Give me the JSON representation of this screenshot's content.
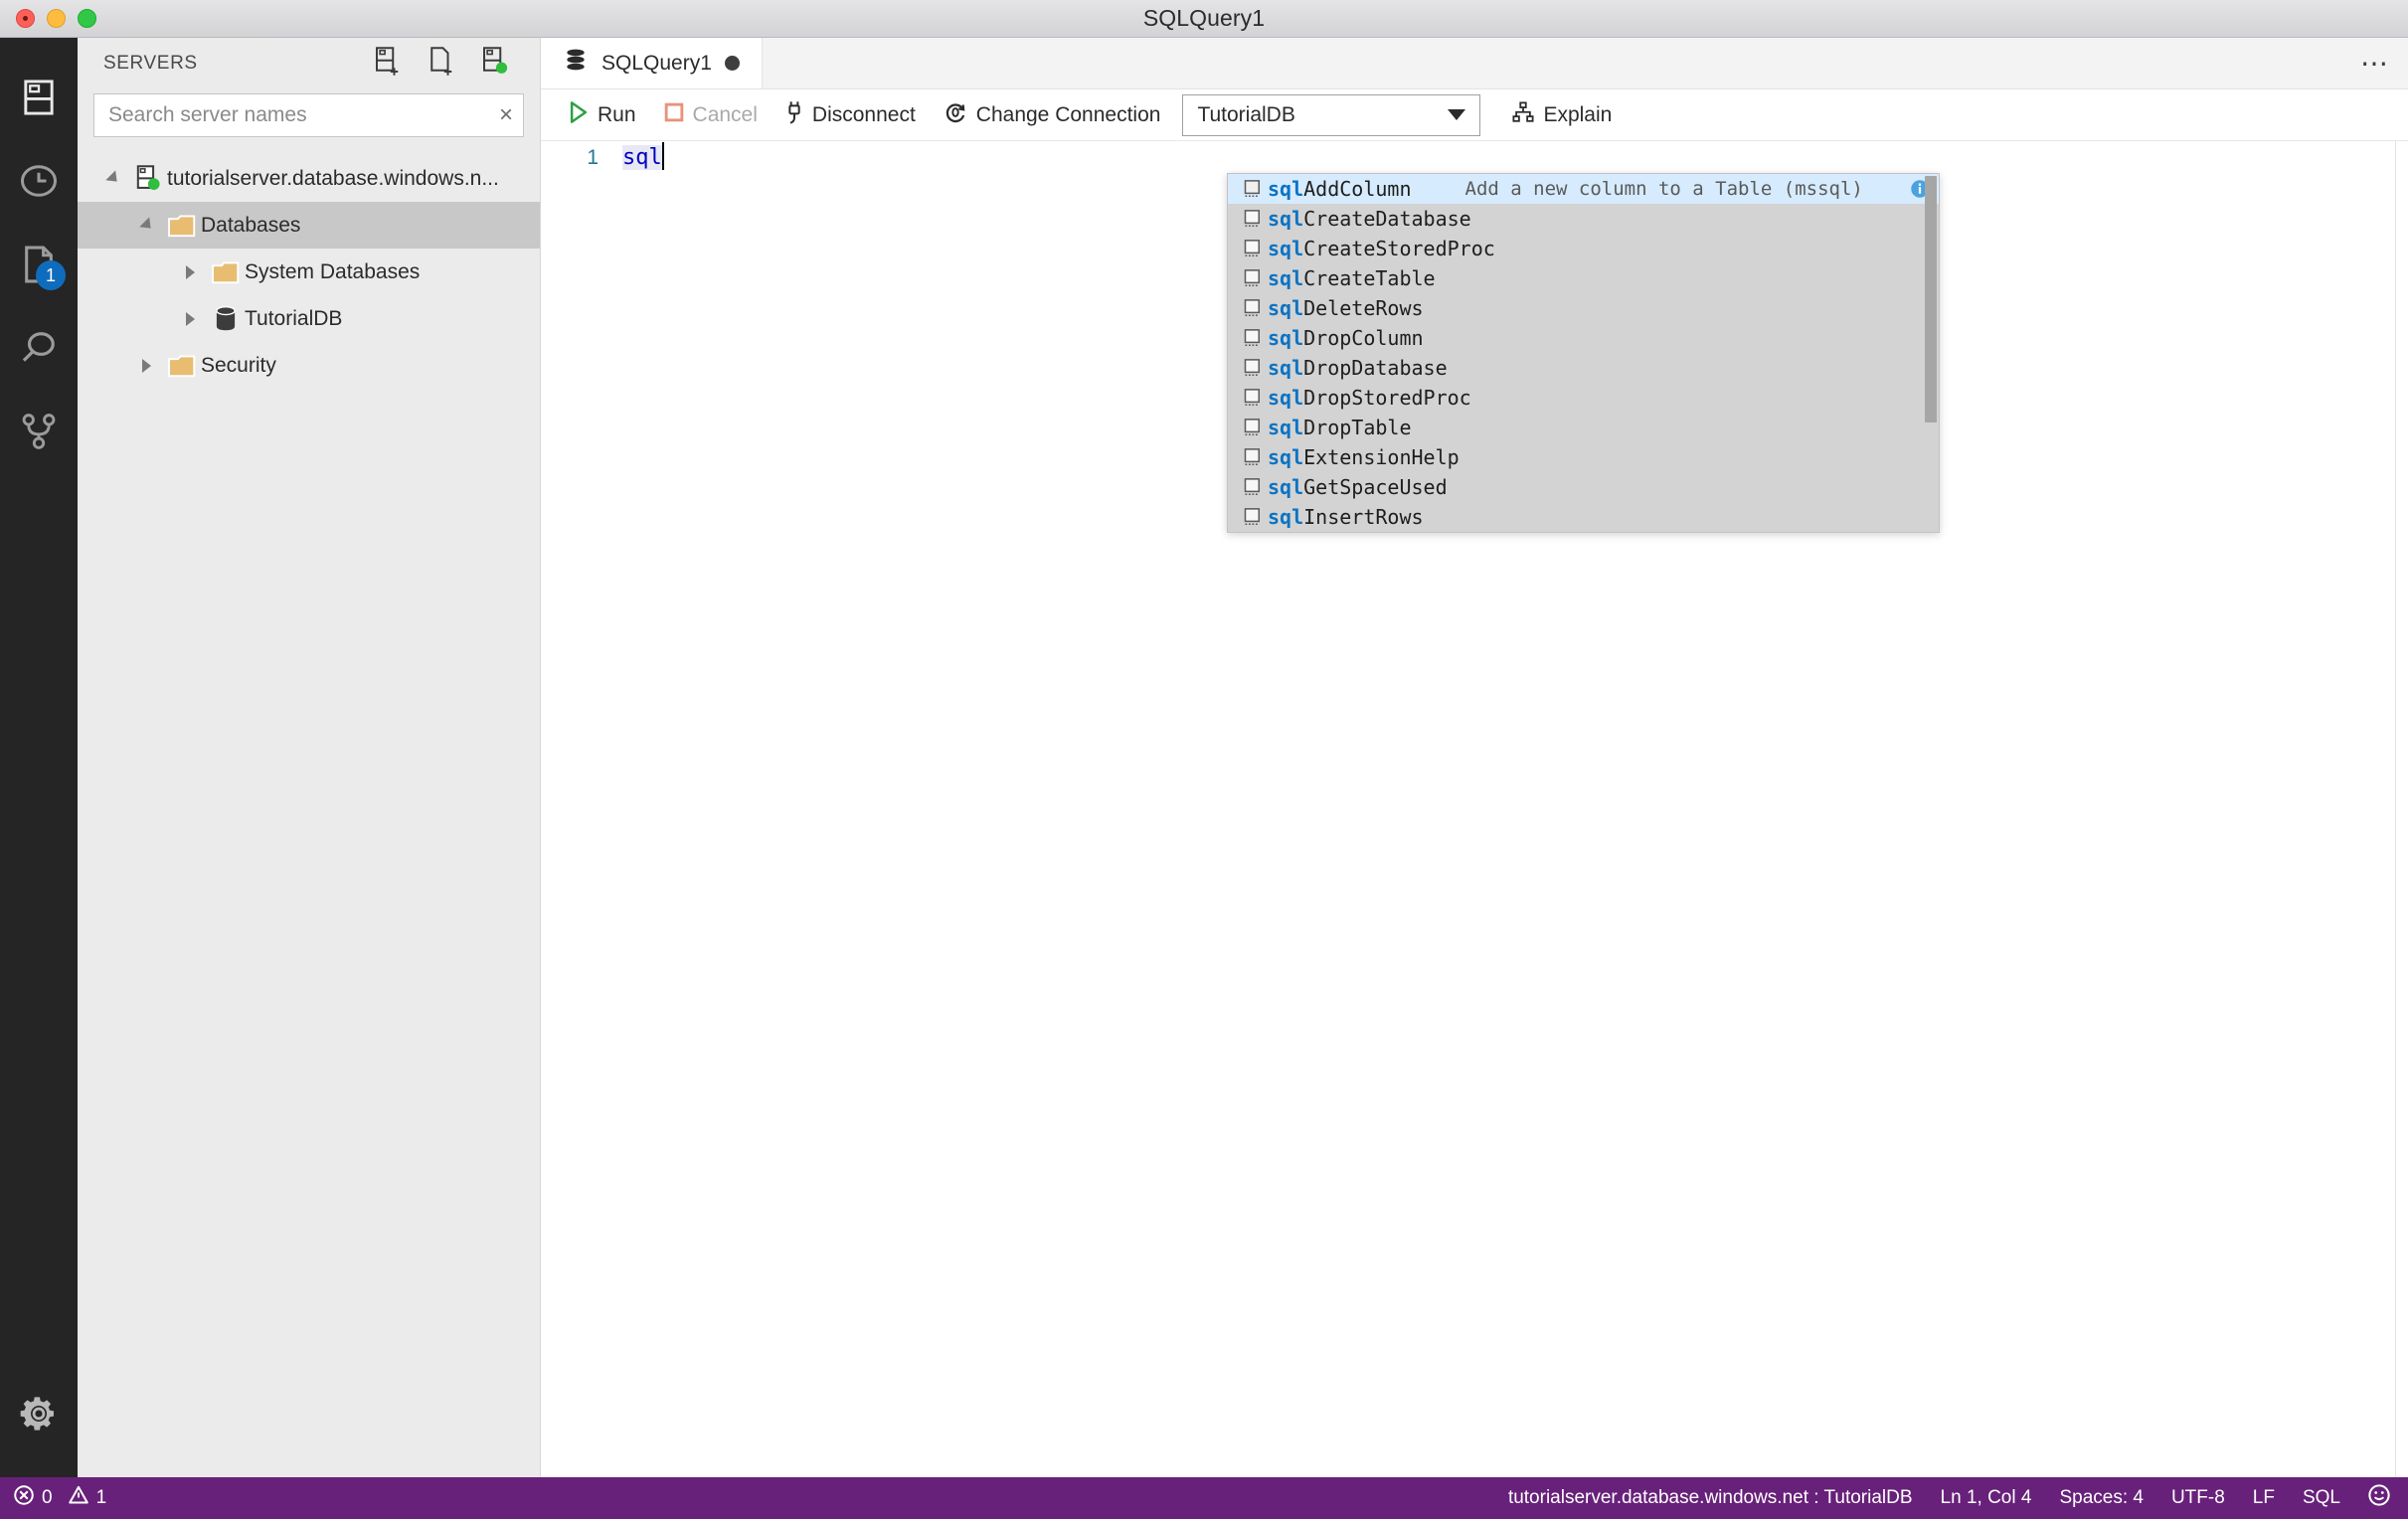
{
  "window": {
    "title": "SQLQuery1",
    "traffic_lights": [
      "close-button",
      "minimize-button",
      "maximize-button"
    ]
  },
  "activity_bar": {
    "items": [
      {
        "name": "servers-icon",
        "label": "Servers",
        "badge": null,
        "active": true
      },
      {
        "name": "history-icon",
        "label": "Query History",
        "badge": null,
        "active": false
      },
      {
        "name": "file-icon",
        "label": "Open Editors",
        "badge": "1",
        "active": false
      },
      {
        "name": "search-icon",
        "label": "Search",
        "badge": null,
        "active": false
      },
      {
        "name": "source-control-icon",
        "label": "Source Control",
        "badge": null,
        "active": false
      }
    ],
    "bottom_items": [
      {
        "name": "gear-icon",
        "label": "Manage"
      }
    ],
    "badge_color": "#0f6cbd"
  },
  "sidebar": {
    "title": "SERVERS",
    "actions": [
      {
        "name": "new-connection-icon",
        "label": "New Connection"
      },
      {
        "name": "new-query-icon",
        "label": "New Query"
      },
      {
        "name": "new-server-group-icon",
        "label": "New Server Group"
      }
    ],
    "search": {
      "placeholder": "Search server names",
      "value": "",
      "clear_label": "×"
    },
    "tree": [
      {
        "label": "tutorialserver.database.windows.n...",
        "icon": "server-connected-icon",
        "indent": 0,
        "state": "expanded",
        "selected": false
      },
      {
        "label": "Databases",
        "icon": "folder-icon",
        "indent": 1,
        "state": "expanded",
        "selected": true
      },
      {
        "label": "System Databases",
        "icon": "folder-icon",
        "indent": 2,
        "state": "collapsed",
        "selected": false
      },
      {
        "label": "TutorialDB",
        "icon": "database-icon",
        "indent": 2,
        "state": "collapsed",
        "selected": false
      },
      {
        "label": "Security",
        "icon": "folder-icon",
        "indent": 1,
        "state": "collapsed",
        "selected": false
      }
    ]
  },
  "editor": {
    "tab": {
      "label": "SQLQuery1",
      "icon": "query-document-icon",
      "dirty": true
    },
    "more_actions_label": "⋯",
    "toolbar": {
      "run_label": "Run",
      "cancel_label": "Cancel",
      "cancel_disabled": true,
      "disconnect_label": "Disconnect",
      "change_connection_label": "Change Connection",
      "database_value": "TutorialDB",
      "explain_label": "Explain",
      "run_icon_color": "#2ea043",
      "cancel_icon_color": "#e8927c"
    },
    "code": {
      "line_number": "1",
      "text": "sql",
      "text_color": "#0000c0"
    }
  },
  "suggest": {
    "scrollbar_visible": true,
    "items": [
      {
        "prefix": "sql",
        "rest": "AddColumn",
        "detail": "Add a new column to a Table (mssql)",
        "info_icon": true,
        "selected": true
      },
      {
        "prefix": "sql",
        "rest": "CreateDatabase",
        "detail": "",
        "info_icon": false,
        "selected": false
      },
      {
        "prefix": "sql",
        "rest": "CreateStoredProc",
        "detail": "",
        "info_icon": false,
        "selected": false
      },
      {
        "prefix": "sql",
        "rest": "CreateTable",
        "detail": "",
        "info_icon": false,
        "selected": false
      },
      {
        "prefix": "sql",
        "rest": "DeleteRows",
        "detail": "",
        "info_icon": false,
        "selected": false
      },
      {
        "prefix": "sql",
        "rest": "DropColumn",
        "detail": "",
        "info_icon": false,
        "selected": false
      },
      {
        "prefix": "sql",
        "rest": "DropDatabase",
        "detail": "",
        "info_icon": false,
        "selected": false
      },
      {
        "prefix": "sql",
        "rest": "DropStoredProc",
        "detail": "",
        "info_icon": false,
        "selected": false
      },
      {
        "prefix": "sql",
        "rest": "DropTable",
        "detail": "",
        "info_icon": false,
        "selected": false
      },
      {
        "prefix": "sql",
        "rest": "ExtensionHelp",
        "detail": "",
        "info_icon": false,
        "selected": false
      },
      {
        "prefix": "sql",
        "rest": "GetSpaceUsed",
        "detail": "",
        "info_icon": false,
        "selected": false
      },
      {
        "prefix": "sql",
        "rest": "InsertRows",
        "detail": "",
        "info_icon": false,
        "selected": false
      }
    ],
    "highlight_color": "#0a73c4",
    "selected_bg": "#d6ebfd",
    "bg": "#d3d3d3"
  },
  "status_bar": {
    "background": "#68217a",
    "errors_count": "0",
    "warnings_count": "1",
    "connection": "tutorialserver.database.windows.net : TutorialDB",
    "cursor_position": "Ln 1, Col 4",
    "indentation": "Spaces: 4",
    "encoding": "UTF-8",
    "eol": "LF",
    "language": "SQL",
    "feedback_icon": "smiley-icon"
  }
}
